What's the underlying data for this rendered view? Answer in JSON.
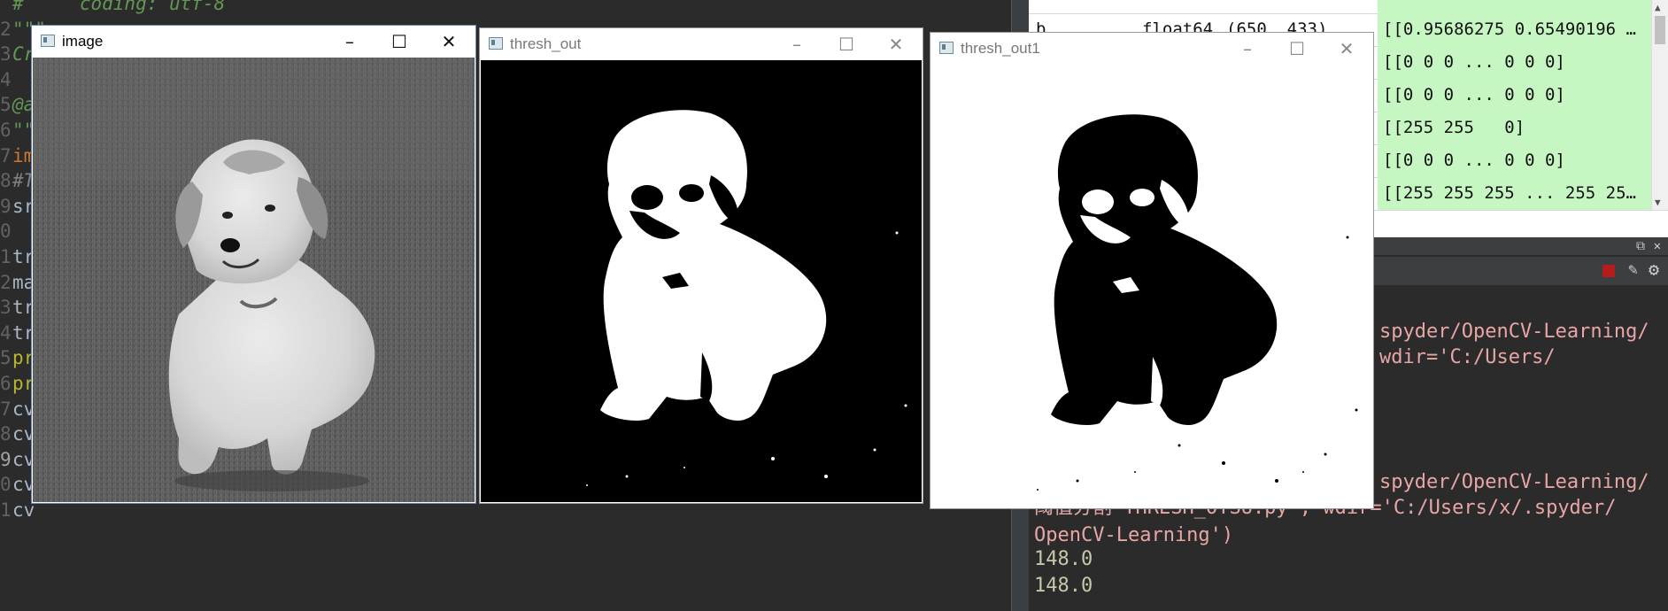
{
  "editor": {
    "lines": [
      {
        "num": "",
        "tokens": [
          {
            "t": "#     coding: utf-8",
            "c": "c-str"
          }
        ]
      },
      {
        "num": "2",
        "tokens": [
          {
            "t": "\"\"\"",
            "c": "c-str"
          }
        ]
      },
      {
        "num": "3",
        "tokens": [
          {
            "t": "Cr",
            "c": "c-str"
          }
        ]
      },
      {
        "num": "4",
        "tokens": [
          {
            "t": "",
            "c": "code"
          }
        ]
      },
      {
        "num": "5",
        "tokens": [
          {
            "t": "@a",
            "c": "c-str"
          }
        ]
      },
      {
        "num": "6",
        "tokens": [
          {
            "t": "\"\"",
            "c": "c-str"
          }
        ]
      },
      {
        "num": "7",
        "tokens": [
          {
            "t": "im",
            "c": "c-kw"
          }
        ]
      },
      {
        "num": "8",
        "tokens": [
          {
            "t": "#T",
            "c": "c-cm"
          }
        ]
      },
      {
        "num": "9",
        "tokens": [
          {
            "t": "sr",
            "c": "code"
          }
        ]
      },
      {
        "num": "0",
        "tokens": [
          {
            "t": "",
            "c": "code"
          }
        ]
      },
      {
        "num": "1",
        "tokens": [
          {
            "t": "tr",
            "c": "code"
          }
        ]
      },
      {
        "num": "2",
        "tokens": [
          {
            "t": "ma",
            "c": "code"
          }
        ]
      },
      {
        "num": "3",
        "tokens": [
          {
            "t": "tr",
            "c": "code"
          }
        ]
      },
      {
        "num": "4",
        "tokens": [
          {
            "t": "tr",
            "c": "code"
          }
        ]
      },
      {
        "num": "5",
        "tokens": [
          {
            "t": "pr",
            "c": "c-dec"
          }
        ]
      },
      {
        "num": "6",
        "tokens": [
          {
            "t": "pr",
            "c": "c-dec"
          }
        ]
      },
      {
        "num": "7",
        "tokens": [
          {
            "t": "cv",
            "c": "code"
          }
        ]
      },
      {
        "num": "8",
        "tokens": [
          {
            "t": "cv",
            "c": "code"
          }
        ]
      },
      {
        "num": "9",
        "tokens": [
          {
            "t": "cv",
            "c": "code"
          }
        ],
        "current": true
      },
      {
        "num": "0",
        "tokens": [
          {
            "t": "cv",
            "c": "code"
          }
        ]
      },
      {
        "num": "1",
        "tokens": [
          {
            "t": "cv",
            "c": "code"
          }
        ]
      }
    ]
  },
  "variable_explorer": {
    "rows": [
      {
        "name": "",
        "type": "",
        "size": "",
        "value": ""
      },
      {
        "name": "b",
        "type": "float64",
        "size": "(650, 433)",
        "value": "[[0.95686275 0.65490196 …"
      },
      {
        "name": "",
        "type": "",
        "size": "",
        "value": "[[0 0 0 ... 0 0 0]"
      },
      {
        "name": "",
        "type": "",
        "size": "",
        "value": "[[0 0 0 ... 0 0 0]"
      },
      {
        "name": "",
        "type": "",
        "size": "",
        "value": "[[255 255   0]"
      },
      {
        "name": "",
        "type": "",
        "size": "",
        "value": "[[0 0 0 ... 0 0 0]"
      },
      {
        "name": "",
        "type": "",
        "size": "",
        "value": "[[255 255 255 ... 255 25…"
      }
    ]
  },
  "console": {
    "lines": [
      {
        "text": "spyder/OpenCV-Learning/",
        "style": "pink",
        "indent": 390
      },
      {
        "text": "wdir='C:/Users/",
        "style": "pink",
        "indent": 390
      },
      {
        "text": "spyder/OpenCV-Learning/",
        "style": "pink",
        "indent": 390
      },
      {
        "text": "阈值分割-THRESH_OTSU.py', wdir='C:/Users/x/.spyder/",
        "style": "pink",
        "indent": 0
      },
      {
        "text": "OpenCV-Learning')",
        "style": "pink",
        "indent": 0
      },
      {
        "text": "148.0",
        "style": "num",
        "indent": 0
      },
      {
        "text": "148.0",
        "style": "num",
        "indent": 0
      }
    ]
  },
  "windows": [
    {
      "title": "image",
      "kind": "grayscale"
    },
    {
      "title": "thresh_out",
      "kind": "binary"
    },
    {
      "title": "thresh_out1",
      "kind": "binary-inverted"
    }
  ],
  "window_buttons": {
    "minimize": "–",
    "maximize": "☐",
    "close": "✕"
  },
  "colors": {
    "grass": "#5c5c5c",
    "dog": "#d9d9d9",
    "editor_bg": "#2b2b2b",
    "var_value_bg": "#c6f7c2"
  }
}
